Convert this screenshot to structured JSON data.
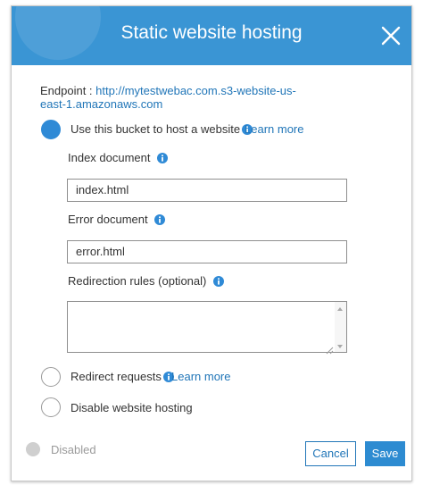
{
  "header": {
    "title": "Static website hosting"
  },
  "endpoint": {
    "label": "Endpoint :",
    "url": "http://mytestwebac.com.s3-website-us-east-1.amazonaws.com"
  },
  "options": [
    {
      "label": "Use this bucket to host a website",
      "learn_more": "Learn more",
      "selected": true
    },
    {
      "label": "Redirect requests",
      "learn_more": "Learn more",
      "selected": false
    },
    {
      "label": "Disable website hosting",
      "selected": false
    }
  ],
  "fields": {
    "index_label": "Index document",
    "index_value": "index.html",
    "error_label": "Error document",
    "error_value": "error.html",
    "redirection_label": "Redirection rules (optional)",
    "redirection_value": ""
  },
  "footer": {
    "status": "Disabled",
    "cancel": "Cancel",
    "save": "Save"
  },
  "colors": {
    "header_bg": "#3a95d4",
    "accent": "#2176b8",
    "primary_button": "#2d8bd1",
    "radio_selected": "#2f8ad6"
  }
}
